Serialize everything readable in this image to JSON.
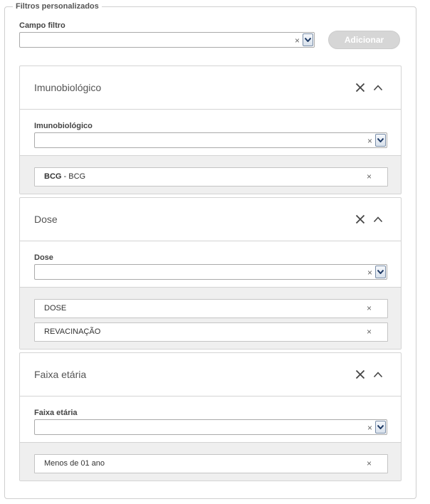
{
  "section": {
    "legend": "Filtros personalizados"
  },
  "campo_filtro": {
    "label": "Campo filtro",
    "value": "",
    "clear": "×"
  },
  "add_button": {
    "label": "Adicionar"
  },
  "panels": [
    {
      "title": "Imunobiológico",
      "field_label": "Imunobiológico",
      "field_value": "",
      "values": [
        {
          "code": "BCG",
          "separator": " - ",
          "label": "BCG"
        }
      ]
    },
    {
      "title": "Dose",
      "field_label": "Dose",
      "field_value": "",
      "values": [
        {
          "label": "DOSE"
        },
        {
          "label": "REVACINAÇÃO"
        }
      ]
    },
    {
      "title": "Faixa etária",
      "field_label": "Faixa etária",
      "field_value": "",
      "values": [
        {
          "label": "Menos de 01 ano"
        }
      ]
    }
  ],
  "symbols": {
    "clear": "×",
    "remove": "×"
  },
  "icons": {
    "close": "close-icon",
    "collapse": "chevron-up-icon",
    "dropdown": "chevron-down-icon"
  },
  "colors": {
    "button_disabled": "#d6d6d6",
    "values_bg": "#efefef",
    "dropdown_border": "#7a8ea8"
  }
}
